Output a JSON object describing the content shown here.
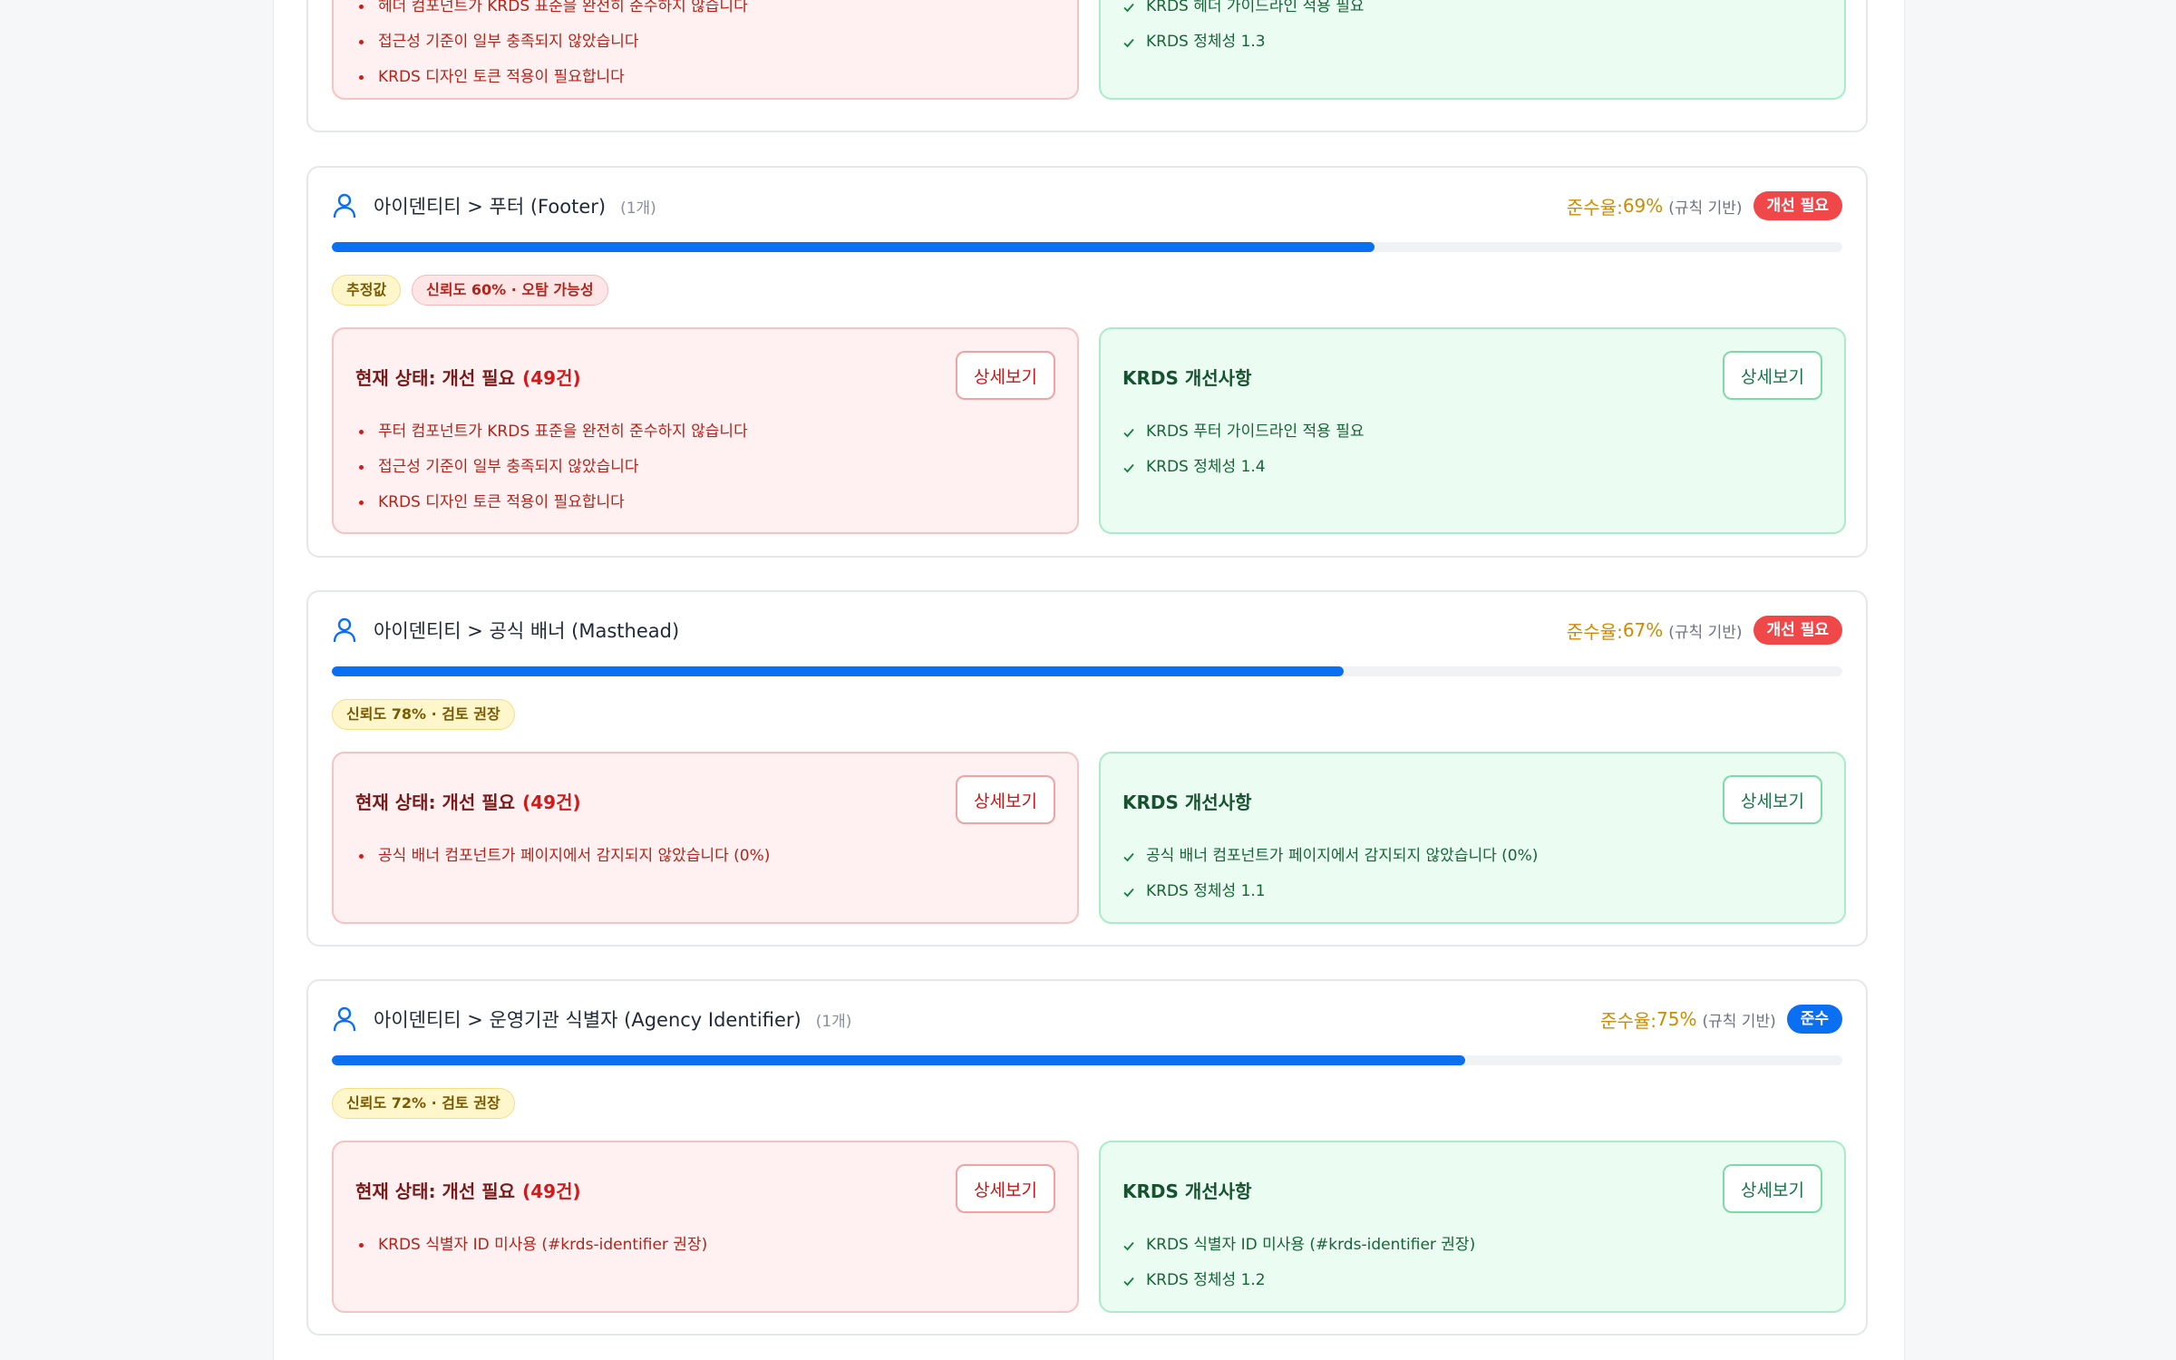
{
  "top_card": {
    "problems": [
      "헤더 컴포넌트가 KRDS 표준을 완전히 준수하지 않습니다",
      "접근성 기준이 일부 충족되지 않았습니다",
      "KRDS 디자인 토큰 적용이 필요합니다"
    ],
    "improvements": [
      "KRDS 헤더 가이드라인 적용 필요",
      "KRDS 정체성 1.3"
    ]
  },
  "cards": [
    {
      "title": "아이덴티티 > 푸터 (Footer)",
      "count": "(1개)",
      "rate_label": "준수율: ",
      "rate_value": "69%",
      "rate_basis": "(규칙 기반)",
      "progress": 0.69,
      "status": "개선 필요",
      "status_color": "#f04848",
      "tags": [
        {
          "text": "추정값",
          "style": "yellow"
        },
        {
          "text": "신뢰도 60% · 오탐 가능성",
          "style": "red"
        }
      ],
      "problem_title": "현재 상태: 개선 필요",
      "problem_count": "(49건)",
      "problem_button": "상세보기",
      "problems": [
        "푸터 컴포넌트가 KRDS 표준을 완전히 준수하지 않습니다",
        "접근성 기준이 일부 충족되지 않았습니다",
        "KRDS 디자인 토큰 적용이 필요합니다"
      ],
      "improvement_title": "KRDS 개선사항",
      "improvement_button": "상세보기",
      "improvements": [
        "KRDS 푸터 가이드라인 적용 필요",
        "KRDS 정체성 1.4"
      ]
    },
    {
      "title": "아이덴티티 > 공식 배너 (Masthead)",
      "count": "",
      "rate_label": "준수율: ",
      "rate_value": "67%",
      "rate_basis": "(규칙 기반)",
      "progress": 0.67,
      "status": "개선 필요",
      "status_color": "#f04848",
      "tags": [
        {
          "text": "신뢰도 78% · 검토 권장",
          "style": "yellow"
        }
      ],
      "problem_title": "현재 상태: 개선 필요",
      "problem_count": "(49건)",
      "problem_button": "상세보기",
      "problems": [
        "공식 배너 컴포넌트가 페이지에서 감지되지 않았습니다 (0%)"
      ],
      "improvement_title": "KRDS 개선사항",
      "improvement_button": "상세보기",
      "improvements": [
        "공식 배너 컴포넌트가 페이지에서 감지되지 않았습니다 (0%)",
        "KRDS 정체성 1.1"
      ]
    },
    {
      "title": "아이덴티티 > 운영기관 식별자 (Agency Identifier)",
      "count": "(1개)",
      "rate_label": "준수율: ",
      "rate_value": "75%",
      "rate_basis": "(규칙 기반)",
      "progress": 0.75,
      "status": "준수",
      "status_color": "#0b6ff2",
      "tags": [
        {
          "text": "신뢰도 72% · 검토 권장",
          "style": "yellow"
        }
      ],
      "problem_title": "현재 상태: 개선 필요",
      "problem_count": "(49건)",
      "problem_button": "상세보기",
      "problems": [
        "KRDS 식별자 ID 미사용 (#krds-identifier 권장)"
      ],
      "improvement_title": "KRDS 개선사항",
      "improvement_button": "상세보기",
      "improvements": [
        "KRDS 식별자 ID 미사용 (#krds-identifier 권장)",
        "KRDS 정체성 1.2"
      ]
    }
  ]
}
